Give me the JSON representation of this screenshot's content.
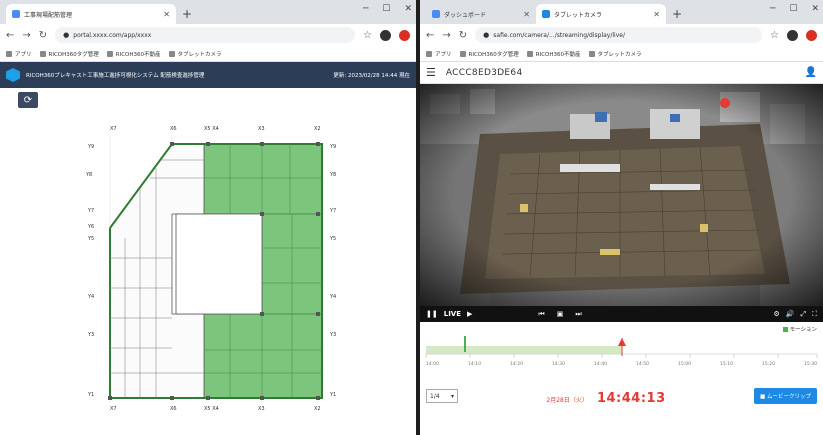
{
  "left_window": {
    "tab_title": "工事現場配筋管理",
    "url": "portal.xxxx.com/app/xxxx",
    "bookmarks": [
      "アプリ",
      "RICOH360タグ管理",
      "RICOH360不動産",
      "タブレットカメラ"
    ],
    "app_title": "RICOH360プレキャスト工事施工進捗可視化システム 配筋検査進捗管理",
    "app_time": "更新: 2023/02/28 14:44 現在"
  },
  "right_window": {
    "tabs": [
      "ダッシュボード",
      "タブレットカメラ"
    ],
    "url": "safie.com/camera/.../streaming/display/live/",
    "bookmarks": [
      "アプリ",
      "RICOH360タグ管理",
      "RICOH360不動産",
      "タブレットカメラ"
    ],
    "camera_id": "ACCC8ED3DE64",
    "live_label": "LIVE",
    "motion_label": "モーション",
    "tick_labels": [
      "14:00",
      "14:10",
      "14:20",
      "14:30",
      "14:40",
      "14:50",
      "15:00",
      "15:10",
      "15:20",
      "15:30"
    ],
    "speed": "1/4",
    "date": "2月28日（火）",
    "time": "14:44:13",
    "clip_button": "ムービークリップ"
  },
  "colors": {
    "progress_green": "#7dc47d",
    "header_navy": "#2c3e57",
    "accent_red": "#e53935",
    "accent_blue": "#1e88e5"
  }
}
